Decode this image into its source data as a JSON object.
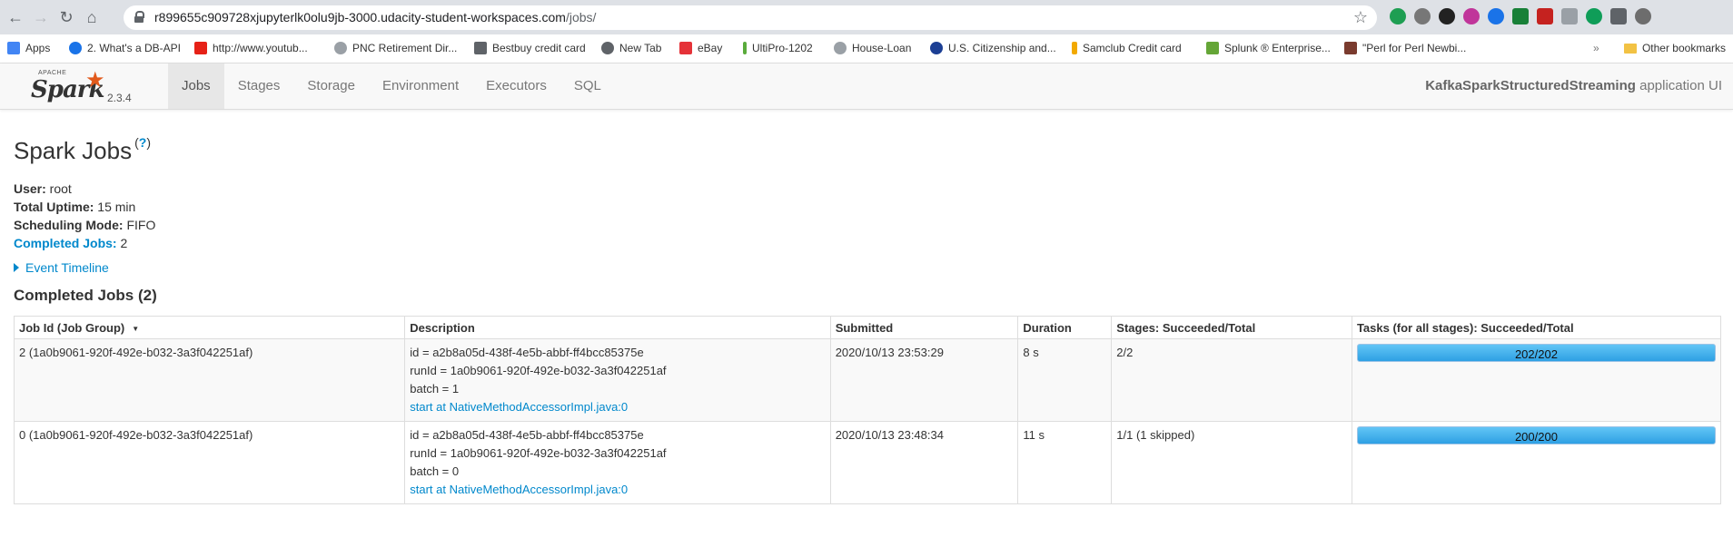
{
  "browser": {
    "url_host": "r899655c909728xjupyterlk0olu9jb-3000.udacity-student-workspaces.com",
    "url_path": "/jobs/",
    "bookmarks": [
      {
        "label": "Apps",
        "color": "#4285f4"
      },
      {
        "label": "2. What's a DB-API",
        "color": "#1a73e8"
      },
      {
        "label": "http://www.youtub...",
        "color": "#e62117"
      },
      {
        "label": "PNC Retirement Dir...",
        "color": "#9aa0a6"
      },
      {
        "label": "Bestbuy credit card",
        "color": "#5f6368"
      },
      {
        "label": "New Tab",
        "color": "#5f6368"
      },
      {
        "label": "eBay",
        "color": "#e53238"
      },
      {
        "label": "UltiPro-1202",
        "color": "#5aab3c"
      },
      {
        "label": "House-Loan",
        "color": "#9aa0a6"
      },
      {
        "label": "U.S. Citizenship and...",
        "color": "#1c3f94"
      },
      {
        "label": "Samclub Credit card",
        "color": "#f2a900"
      },
      {
        "label": "Splunk ® Enterprise...",
        "color": "#65a637"
      },
      {
        "label": "\"Perl for Perl Newbi...",
        "color": "#7a3b2e"
      }
    ],
    "other_bookmarks": "Other bookmarks"
  },
  "spark": {
    "apache_label": "APACHE",
    "brand": "Spark",
    "version": "2.3.4",
    "tabs": [
      "Jobs",
      "Stages",
      "Storage",
      "Environment",
      "Executors",
      "SQL"
    ],
    "active_tab": "Jobs",
    "app_name": "KafkaSparkStructuredStreaming",
    "app_suffix": " application UI"
  },
  "page": {
    "title": "Spark Jobs",
    "help": "?",
    "user_label": "User:",
    "user_value": " root",
    "uptime_label": "Total Uptime:",
    "uptime_value": " 15 min",
    "scheduling_label": "Scheduling Mode:",
    "scheduling_value": " FIFO",
    "completed_label": "Completed Jobs:",
    "completed_value": " 2",
    "event_timeline": "Event Timeline",
    "section_title": "Completed Jobs (2)"
  },
  "table": {
    "headers": [
      "Job Id (Job Group)",
      "Description",
      "Submitted",
      "Duration",
      "Stages: Succeeded/Total",
      "Tasks (for all stages): Succeeded/Total"
    ],
    "rows": [
      {
        "job": "2 (1a0b9061-920f-492e-b032-3a3f042251af)",
        "desc_id": "id = a2b8a05d-438f-4e5b-abbf-ff4bcc85375e",
        "desc_run": "runId = 1a0b9061-920f-492e-b032-3a3f042251af",
        "desc_batch": "batch = 1",
        "desc_link": "start at NativeMethodAccessorImpl.java:0",
        "submitted": "2020/10/13 23:53:29",
        "duration": "8 s",
        "stages": "2/2",
        "tasks": "202/202",
        "tasks_fraction": 1.0
      },
      {
        "job": "0 (1a0b9061-920f-492e-b032-3a3f042251af)",
        "desc_id": "id = a2b8a05d-438f-4e5b-abbf-ff4bcc85375e",
        "desc_run": "runId = 1a0b9061-920f-492e-b032-3a3f042251af",
        "desc_batch": "batch = 0",
        "desc_link": "start at NativeMethodAccessorImpl.java:0",
        "submitted": "2020/10/13 23:48:34",
        "duration": "11 s",
        "stages": "1/1 (1 skipped)",
        "tasks": "200/200",
        "tasks_fraction": 1.0
      }
    ]
  }
}
